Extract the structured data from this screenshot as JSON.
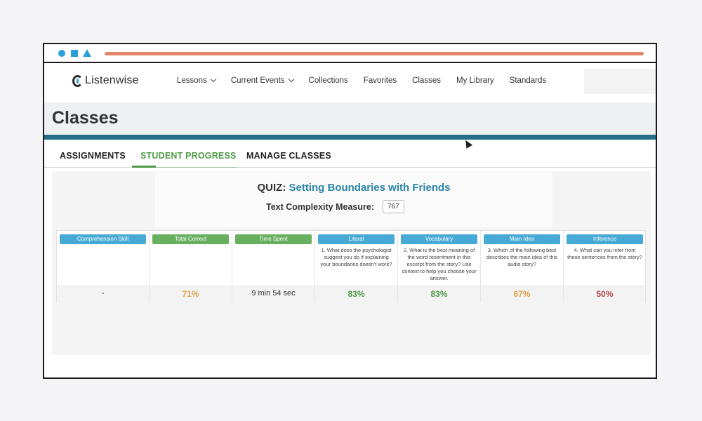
{
  "app": {
    "logo_text": "Listenwise"
  },
  "nav": {
    "items": [
      {
        "label": "Lessons",
        "dropdown": true
      },
      {
        "label": "Current Events",
        "dropdown": true
      },
      {
        "label": "Collections",
        "dropdown": false
      },
      {
        "label": "Favorites",
        "dropdown": false
      },
      {
        "label": "Classes",
        "dropdown": false
      },
      {
        "label": "My Library",
        "dropdown": false
      },
      {
        "label": "Standards",
        "dropdown": false
      }
    ]
  },
  "page": {
    "title": "Classes"
  },
  "tabs": [
    {
      "label": "ASSIGNMENTS",
      "active": false
    },
    {
      "label": "STUDENT PROGRESS",
      "active": true
    },
    {
      "label": "MANAGE CLASSES",
      "active": false
    }
  ],
  "quiz": {
    "prefix": "QUIZ:",
    "name": "Setting Boundaries with Friends",
    "tcm_label": "Text Complexity Measure:",
    "tcm_value": "767"
  },
  "columns": [
    {
      "header": "Comprehension Skill",
      "chip": "blue",
      "question": "",
      "value": "-",
      "value_color": "#333333"
    },
    {
      "header": "Total Correct",
      "chip": "green",
      "question": "",
      "value": "71%",
      "value_color": "#e3a04d"
    },
    {
      "header": "Time Spent",
      "chip": "green",
      "question": "",
      "value": "9 min 54 sec",
      "value_color": "#333333"
    },
    {
      "header": "Literal",
      "chip": "blue",
      "question": "1. What does the psychologist suggest you do if explaining your boundaries doesn't work?",
      "value": "83%",
      "value_color": "#4f9a48"
    },
    {
      "header": "Vocabulary",
      "chip": "blue",
      "question": "2. What is the best meaning of the word resentment in this excerpt from the story? Use context to help you choose your answer.",
      "value": "83%",
      "value_color": "#4f9a48"
    },
    {
      "header": "Main Idea",
      "chip": "blue",
      "question": "3. Which of the following best describes the main idea of this audio story?",
      "value": "67%",
      "value_color": "#e3a04d"
    },
    {
      "header": "Inference",
      "chip": "blue",
      "question": "4. What can you infer from these sentences from the story?",
      "value": "50%",
      "value_color": "#b54a4a"
    }
  ],
  "colors": {
    "accent_blue": "#2b9fd8",
    "teal_bar": "#236d86",
    "green": "#4f9a48",
    "progress_line": "#e3856b"
  }
}
